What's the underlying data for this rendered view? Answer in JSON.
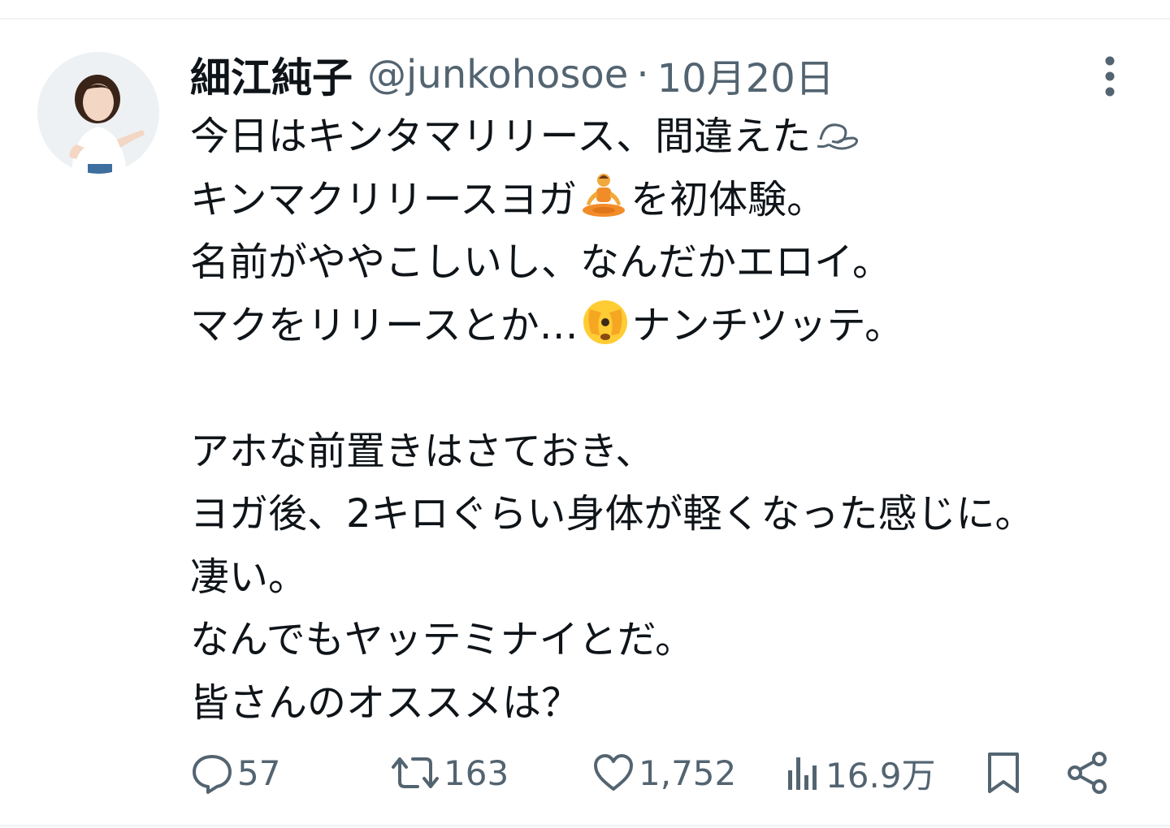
{
  "tweet": {
    "author": {
      "display_name": "細江純子",
      "handle": "@junkohosoe"
    },
    "separator": "·",
    "date": "10月20日",
    "lines": [
      {
        "text": "今日はキンタマリリース、間違えた",
        "after_icon": "dash-emoji"
      },
      {
        "text": "キンマクリリースヨガ",
        "icon": "yoga-emoji",
        "text_after": "を初体験。"
      },
      {
        "text": "名前がややこしいし、なんだかエロイ。"
      },
      {
        "text": "マクをリリースとか…",
        "icon": "peeking-face-emoji",
        "text_after": "ナンチツッテ。"
      },
      {
        "text": ""
      },
      {
        "text": "アホな前置きはさておき、"
      },
      {
        "text": "ヨガ後、2キロぐらい身体が軽くなった感じに。"
      },
      {
        "text": "凄い。"
      },
      {
        "text": "なんでもヤッテミナイとだ。"
      },
      {
        "text": "皆さんのオススメは？"
      }
    ]
  },
  "actions": {
    "reply_count": "57",
    "retweet_count": "163",
    "like_count": "1,752",
    "view_count": "16.9万"
  },
  "icons": [
    "avatar",
    "more-icon",
    "dash-emoji",
    "yoga-emoji",
    "peeking-face-emoji",
    "reply-icon",
    "retweet-icon",
    "like-icon",
    "views-icon",
    "bookmark-icon",
    "share-icon"
  ],
  "colors": {
    "text_primary": "#0f1419",
    "text_secondary": "#536471",
    "divider": "#eff3f4"
  }
}
